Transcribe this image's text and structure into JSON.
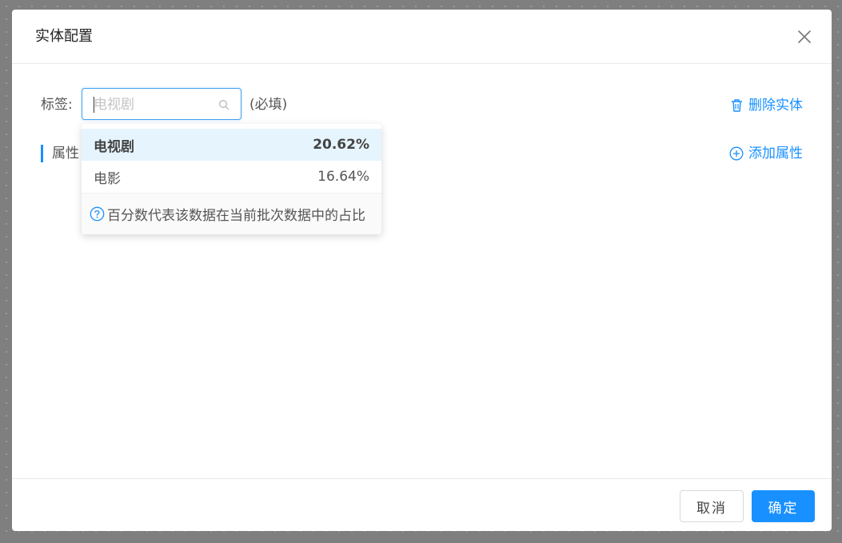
{
  "modal": {
    "title": "实体配置",
    "close_icon": "close-icon"
  },
  "form": {
    "tag_label": "标签:",
    "tag_placeholder": "电视剧",
    "required_hint": "(必填)",
    "delete_entity_label": "删除实体",
    "delete_icon": "trash-icon",
    "attributes_title": "属性",
    "add_attribute_label": "添加属性",
    "add_icon": "plus-circle-icon"
  },
  "dropdown": {
    "options": [
      {
        "label": "电视剧",
        "percent": "20.62%",
        "active": true
      },
      {
        "label": "电影",
        "percent": "16.64%",
        "active": false
      }
    ],
    "hint_icon": "question-circle-icon",
    "hint": "百分数代表该数据在当前批次数据中的占比"
  },
  "footer": {
    "cancel_label": "取消",
    "ok_label": "确定"
  },
  "colors": {
    "accent": "#1890ff",
    "active_option_bg": "#e6f4fd"
  }
}
